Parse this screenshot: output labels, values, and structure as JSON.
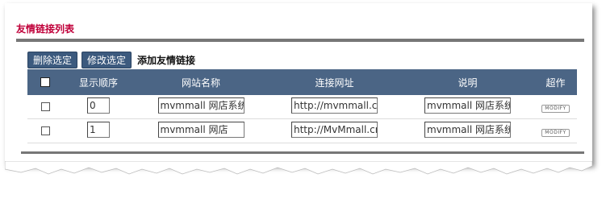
{
  "panel": {
    "title": "友情链接列表"
  },
  "toolbar": {
    "delete_label": "删除选定",
    "edit_label": "修改选定",
    "add_label": "添加友情链接"
  },
  "table": {
    "headers": [
      "显示顺序",
      "网站名称",
      "连接网址",
      "说明",
      "超作"
    ],
    "rows": [
      {
        "order": "0",
        "name": "mvmmall 网店系统",
        "url": "http://mvmmall.cn",
        "desc": "mvmmall 网店系统",
        "action": "MODIFY"
      },
      {
        "order": "1",
        "name": "mvmmall 网店",
        "url": "http://MvMmall.cn",
        "desc": "mvmmall 网店系统",
        "action": "MODIFY"
      }
    ]
  }
}
